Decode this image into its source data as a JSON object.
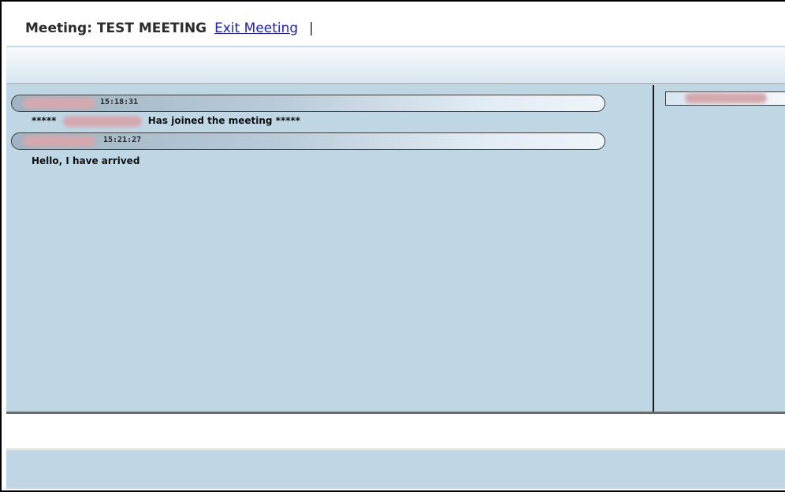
{
  "header": {
    "title": "Meeting: TEST MEETING",
    "exit_label": "Exit Meeting",
    "separator": "|"
  },
  "chat": {
    "messages": [
      {
        "time": "15:18:31",
        "prefix": "*****",
        "text": "Has joined the meeting *****"
      },
      {
        "time": "15:21:27",
        "text": "Hello, I have arrived"
      }
    ]
  },
  "colors": {
    "panel_bg": "#bfd6e5",
    "link": "#1a1ad4",
    "redaction": "#d4a8ae"
  }
}
